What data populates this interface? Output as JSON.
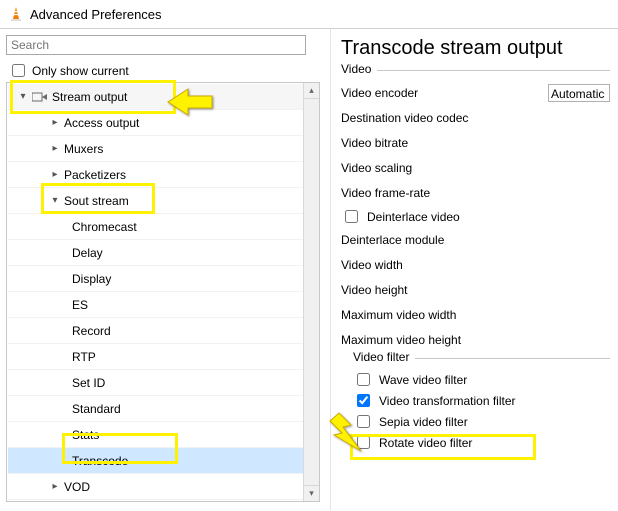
{
  "window": {
    "title": "Advanced Preferences"
  },
  "search": {
    "placeholder": "Search"
  },
  "only_show_current": {
    "label": "Only show current",
    "checked": false
  },
  "tree": {
    "stream_output": {
      "label": "Stream output",
      "expanded": true
    },
    "access_output": {
      "label": "Access output",
      "expanded": false
    },
    "muxers": {
      "label": "Muxers",
      "expanded": false
    },
    "packetizers": {
      "label": "Packetizers",
      "expanded": false
    },
    "sout_stream": {
      "label": "Sout stream",
      "expanded": true
    },
    "chromecast": {
      "label": "Chromecast"
    },
    "delay": {
      "label": "Delay"
    },
    "display": {
      "label": "Display"
    },
    "es": {
      "label": "ES"
    },
    "record": {
      "label": "Record"
    },
    "rtp": {
      "label": "RTP"
    },
    "set_id": {
      "label": "Set ID"
    },
    "standard": {
      "label": "Standard"
    },
    "stats": {
      "label": "Stats"
    },
    "transcode": {
      "label": "Transcode"
    },
    "vod": {
      "label": "VOD",
      "expanded": false
    }
  },
  "pane": {
    "title": "Transcode stream output",
    "group_video": "Video",
    "video_encoder": {
      "label": "Video encoder",
      "value": "Automatic"
    },
    "destination_video_codec": {
      "label": "Destination video codec"
    },
    "video_bitrate": {
      "label": "Video bitrate"
    },
    "video_scaling": {
      "label": "Video scaling"
    },
    "video_frame_rate": {
      "label": "Video frame-rate"
    },
    "deinterlace_video": {
      "label": "Deinterlace video",
      "checked": false
    },
    "deinterlace_module": {
      "label": "Deinterlace module"
    },
    "video_width": {
      "label": "Video width"
    },
    "video_height": {
      "label": "Video height"
    },
    "maximum_video_width": {
      "label": "Maximum video width"
    },
    "maximum_video_height": {
      "label": "Maximum video height"
    },
    "group_video_filter": "Video filter",
    "wave": {
      "label": "Wave video filter",
      "checked": false
    },
    "transform": {
      "label": "Video transformation filter",
      "checked": true
    },
    "sepia": {
      "label": "Sepia video filter",
      "checked": false
    },
    "rotate": {
      "label": "Rotate video filter",
      "checked": false
    }
  }
}
